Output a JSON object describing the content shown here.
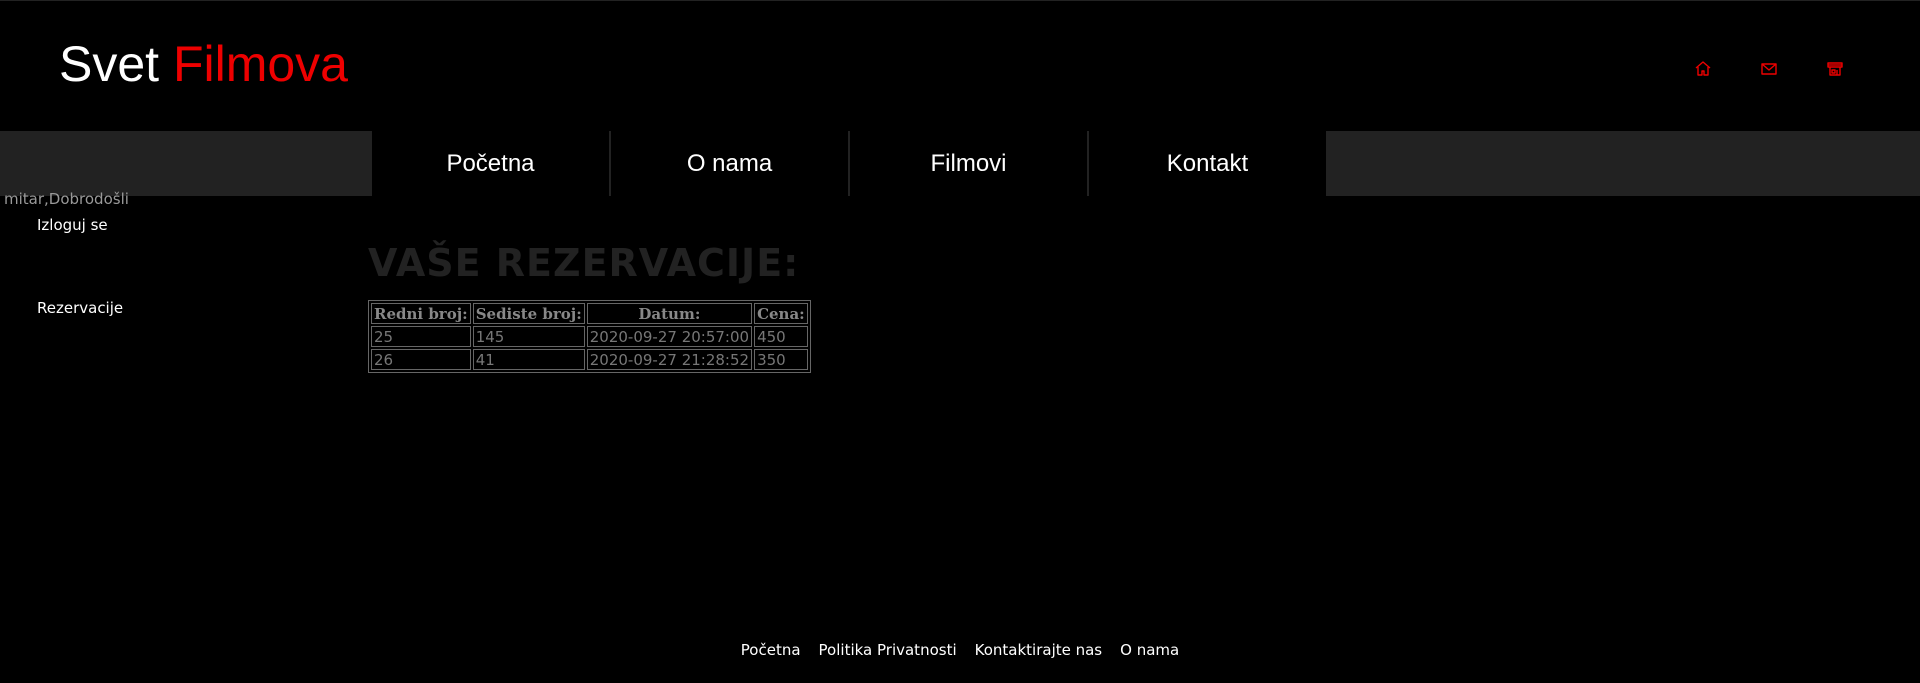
{
  "logo": {
    "part1": "Svet",
    "part2": "Filmova"
  },
  "header_icons": [
    {
      "name": "home-icon"
    },
    {
      "name": "mail-icon"
    },
    {
      "name": "store-icon"
    }
  ],
  "nav": [
    {
      "label": "Početna"
    },
    {
      "label": "O nama"
    },
    {
      "label": "Filmovi"
    },
    {
      "label": "Kontakt"
    }
  ],
  "sidebar": {
    "welcome": "mitar,Dobrodošli",
    "logout": "Izloguj se",
    "reservations": "Rezervacije"
  },
  "main": {
    "title": "VAŠE REZERVACIJE:",
    "columns": [
      "Redni broj:",
      "Sediste broj:",
      "Datum:",
      "Cena:"
    ],
    "rows": [
      [
        "25",
        "145",
        "2020-09-27 20:57:00",
        "450"
      ],
      [
        "26",
        "41",
        "2020-09-27 21:28:52",
        "350"
      ]
    ]
  },
  "footer": [
    {
      "label": "Početna"
    },
    {
      "label": "Politika Privatnosti"
    },
    {
      "label": "Kontaktirajte nas"
    },
    {
      "label": "O nama"
    }
  ],
  "colors": {
    "accent": "#ee0000",
    "background": "#000000",
    "navbar": "#222222"
  }
}
